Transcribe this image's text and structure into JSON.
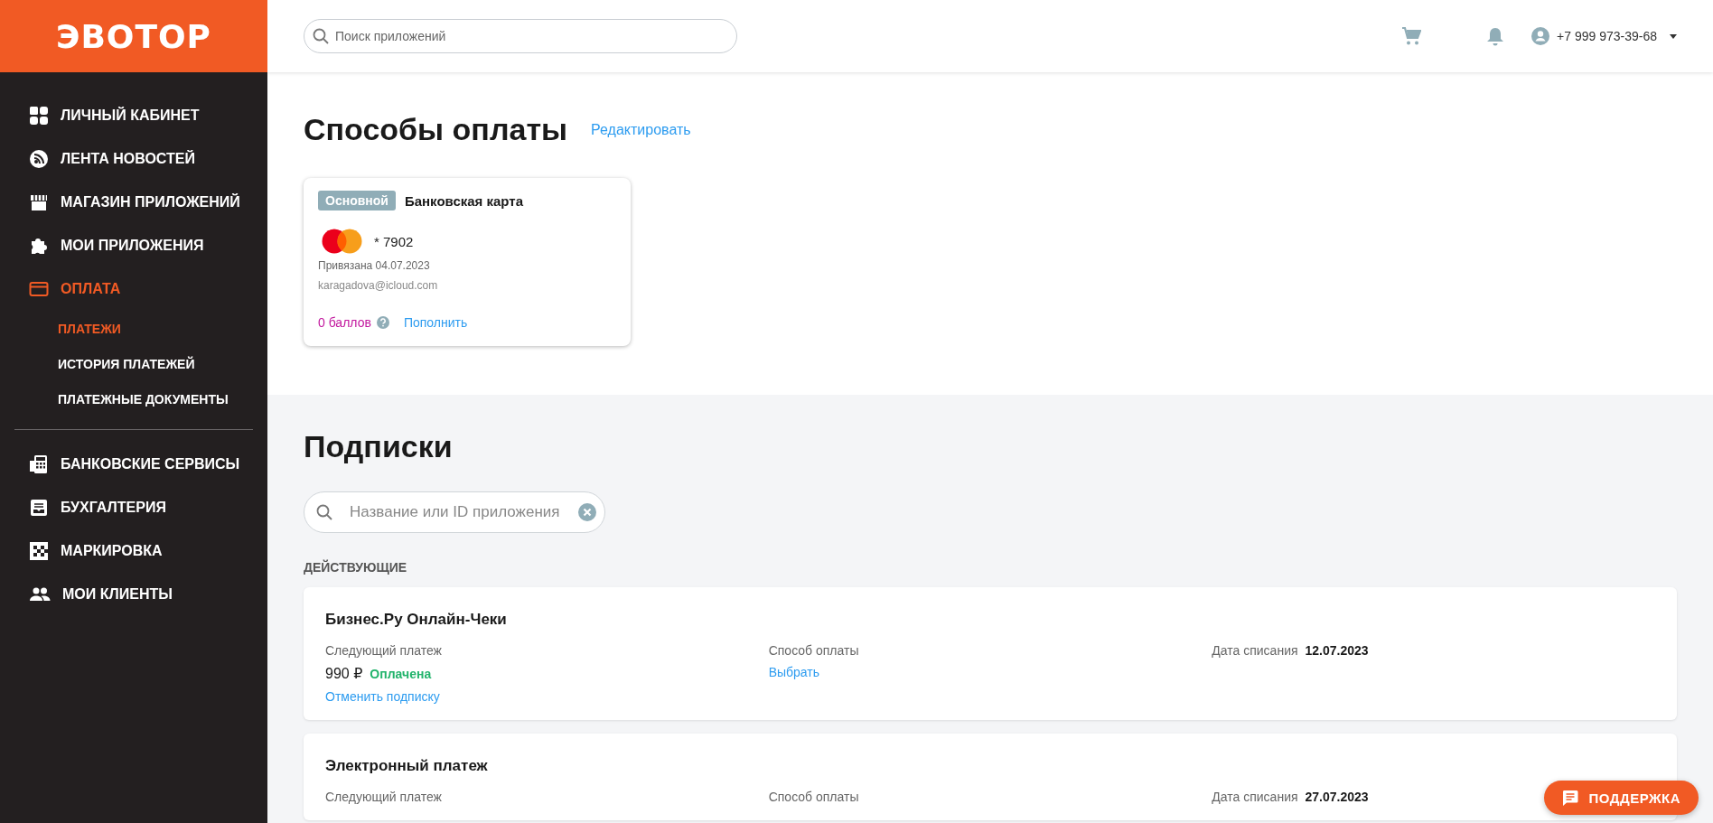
{
  "logo": "ЭВОТОР",
  "sidebar": {
    "groups": [
      {
        "items": [
          {
            "label": "ЛИЧНЫЙ КАБИНЕТ",
            "selected": false
          },
          {
            "label": "ЛЕНТА НОВОСТЕЙ",
            "selected": false
          },
          {
            "label": "МАГАЗИН ПРИЛОЖЕНИЙ",
            "selected": false
          },
          {
            "label": "МОИ ПРИЛОЖЕНИЯ",
            "selected": false
          },
          {
            "label": "ОПЛАТА",
            "selected": true,
            "children": [
              {
                "label": "ПЛАТЕЖИ",
                "selected": true
              },
              {
                "label": "ИСТОРИЯ ПЛАТЕЖЕЙ",
                "selected": false
              },
              {
                "label": "ПЛАТЕЖНЫЕ ДОКУМЕНТЫ",
                "selected": false
              }
            ]
          }
        ]
      },
      {
        "items": [
          {
            "label": "БАНКОВСКИЕ СЕРВИСЫ",
            "selected": false
          },
          {
            "label": "БУХГАЛТЕРИЯ",
            "selected": false
          },
          {
            "label": "МАРКИРОВКА",
            "selected": false
          },
          {
            "label": "МОИ КЛИЕНТЫ",
            "selected": false
          }
        ]
      }
    ]
  },
  "header": {
    "search": {
      "placeholder": "Поиск приложений"
    },
    "phone": "+7 999 973-39-68"
  },
  "payment_methods": {
    "title": "Способы оплаты",
    "edit_link": "Редактировать",
    "cards": [
      {
        "badge": "Основной",
        "title": "Банковская карта",
        "number": "* 7902",
        "linked": "Привязана 04.07.2023",
        "email": "karagadova@icloud.com",
        "points": "0 баллов",
        "topup": "Пополнить"
      }
    ]
  },
  "subscriptions": {
    "title": "Подписки",
    "search": {
      "placeholder": "Название или ID приложения"
    },
    "group_label": "ДЕЙСТВУЮЩИЕ",
    "items": [
      {
        "name": "Бизнес.Ру Онлайн-Чеки",
        "next_label": "Следующий платеж",
        "amount": "990 ₽",
        "status": "Оплачена",
        "cancel": "Отменить подписку",
        "method_label": "Способ оплаты",
        "method_link": "Выбрать",
        "date_label": "Дата списания",
        "date": "12.07.2023"
      },
      {
        "name": "Электронный платеж",
        "next_label": "Следующий платеж",
        "method_label": "Способ оплаты",
        "date_label": "Дата списания",
        "date": "27.07.2023"
      }
    ]
  },
  "support": {
    "label": "ПОДДЕРЖКА"
  }
}
